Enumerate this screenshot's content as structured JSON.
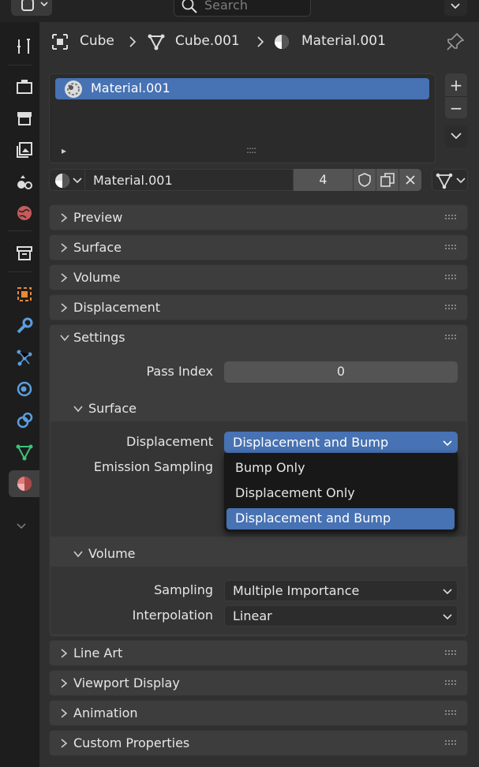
{
  "header": {
    "search_placeholder": "Search"
  },
  "breadcrumb": {
    "object": "Cube",
    "mesh": "Cube.001",
    "material": "Material.001"
  },
  "material_slots": {
    "items": [
      "Material.001"
    ],
    "add_label": "+",
    "remove_label": "−",
    "expand_label": "▸",
    "grip_label": "::::"
  },
  "datablock": {
    "name": "Material.001",
    "users": "4"
  },
  "panels": {
    "preview": "Preview",
    "surface": "Surface",
    "volume": "Volume",
    "displacement": "Displacement",
    "settings": "Settings",
    "line_art": "Line Art",
    "viewport_display": "Viewport Display",
    "animation": "Animation",
    "custom_properties": "Custom Properties"
  },
  "settings": {
    "pass_index_label": "Pass Index",
    "pass_index_value": "0",
    "surface": {
      "title": "Surface",
      "displacement_label": "Displacement",
      "displacement_value": "Displacement and Bump",
      "emission_sampling_label": "Emission Sampling"
    },
    "volume": {
      "title": "Volume",
      "sampling_label": "Sampling",
      "sampling_value": "Multiple Importance",
      "interpolation_label": "Interpolation",
      "interpolation_value": "Linear"
    }
  },
  "displacement_menu": {
    "options": [
      "Bump Only",
      "Displacement Only",
      "Displacement and Bump"
    ],
    "selected_index": 2
  },
  "colors": {
    "accent": "#4772b3",
    "panel": "#3d3d3d",
    "background": "#303030",
    "sidebar": "#1d1d1d"
  },
  "icons": {
    "tabs": [
      "tool-icon",
      "render-icon",
      "output-icon",
      "view-layer-icon",
      "scene-icon",
      "world-icon",
      "collection-icon",
      "object-icon",
      "modifier-icon",
      "particles-icon",
      "physics-icon",
      "constraints-icon",
      "object-data-icon",
      "material-icon"
    ]
  }
}
